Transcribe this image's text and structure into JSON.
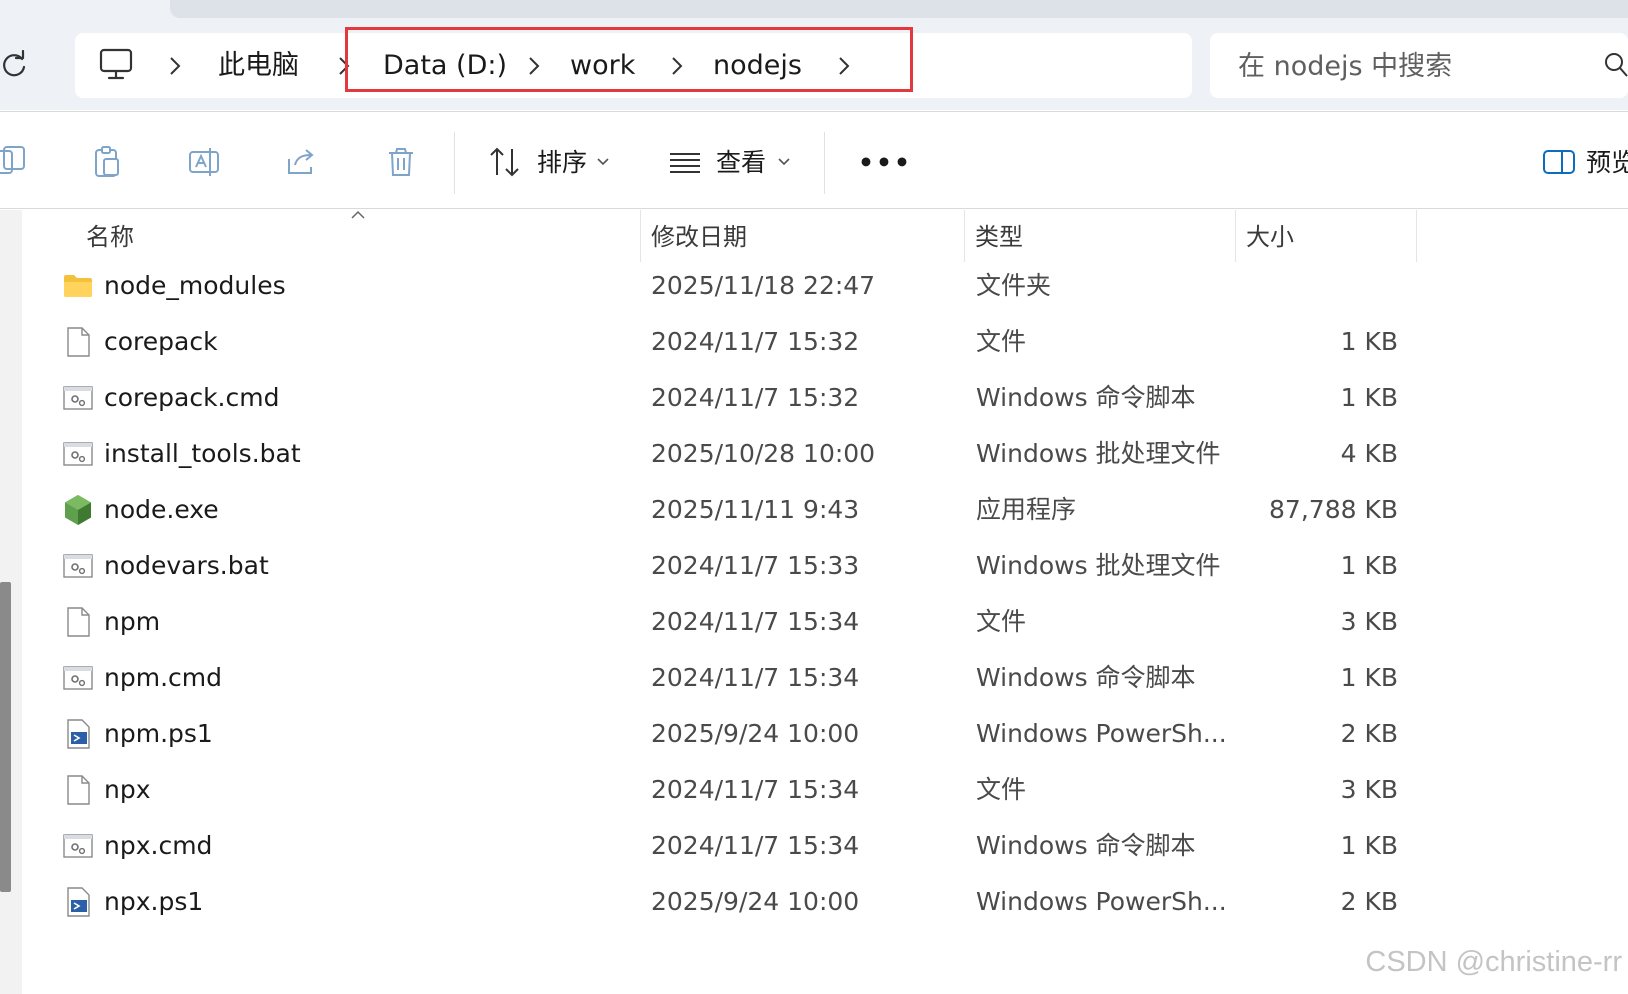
{
  "address": {
    "crumbs": [
      "此电脑",
      "Data (D:)",
      "work",
      "nodejs"
    ]
  },
  "search": {
    "placeholder": "在 nodejs 中搜索"
  },
  "toolbar": {
    "sort_label": "排序",
    "view_label": "查看",
    "more_label": "•••",
    "preview_label": "预览"
  },
  "columns": {
    "name": "名称",
    "date": "修改日期",
    "type": "类型",
    "size": "大小"
  },
  "files": [
    {
      "name": "node_modules",
      "date": "2025/11/18 22:47",
      "type": "文件夹",
      "size": "",
      "icon": "folder-icon"
    },
    {
      "name": "corepack",
      "date": "2024/11/7 15:32",
      "type": "文件",
      "size": "1 KB",
      "icon": "file-icon"
    },
    {
      "name": "corepack.cmd",
      "date": "2024/11/7 15:32",
      "type": "Windows 命令脚本",
      "size": "1 KB",
      "icon": "script-icon"
    },
    {
      "name": "install_tools.bat",
      "date": "2025/10/28 10:00",
      "type": "Windows 批处理文件",
      "size": "4 KB",
      "icon": "script-icon"
    },
    {
      "name": "node.exe",
      "date": "2025/11/11 9:43",
      "type": "应用程序",
      "size": "87,788 KB",
      "icon": "nodejs-hexagon-icon"
    },
    {
      "name": "nodevars.bat",
      "date": "2024/11/7 15:33",
      "type": "Windows 批处理文件",
      "size": "1 KB",
      "icon": "script-icon"
    },
    {
      "name": "npm",
      "date": "2024/11/7 15:34",
      "type": "文件",
      "size": "3 KB",
      "icon": "file-icon"
    },
    {
      "name": "npm.cmd",
      "date": "2024/11/7 15:34",
      "type": "Windows 命令脚本",
      "size": "1 KB",
      "icon": "script-icon"
    },
    {
      "name": "npm.ps1",
      "date": "2025/9/24 10:00",
      "type": "Windows PowerSh...",
      "size": "2 KB",
      "icon": "powershell-icon"
    },
    {
      "name": "npx",
      "date": "2024/11/7 15:34",
      "type": "文件",
      "size": "3 KB",
      "icon": "file-icon"
    },
    {
      "name": "npx.cmd",
      "date": "2024/11/7 15:34",
      "type": "Windows 命令脚本",
      "size": "1 KB",
      "icon": "script-icon"
    },
    {
      "name": "npx.ps1",
      "date": "2025/9/24 10:00",
      "type": "Windows PowerSh...",
      "size": "2 KB",
      "icon": "powershell-icon"
    }
  ],
  "watermark": "CSDN @christine-rr",
  "colors": {
    "highlight": "#e2383e",
    "folder": "#f3c23c",
    "node": "#5fa04e",
    "accent": "#0f6cbd"
  }
}
